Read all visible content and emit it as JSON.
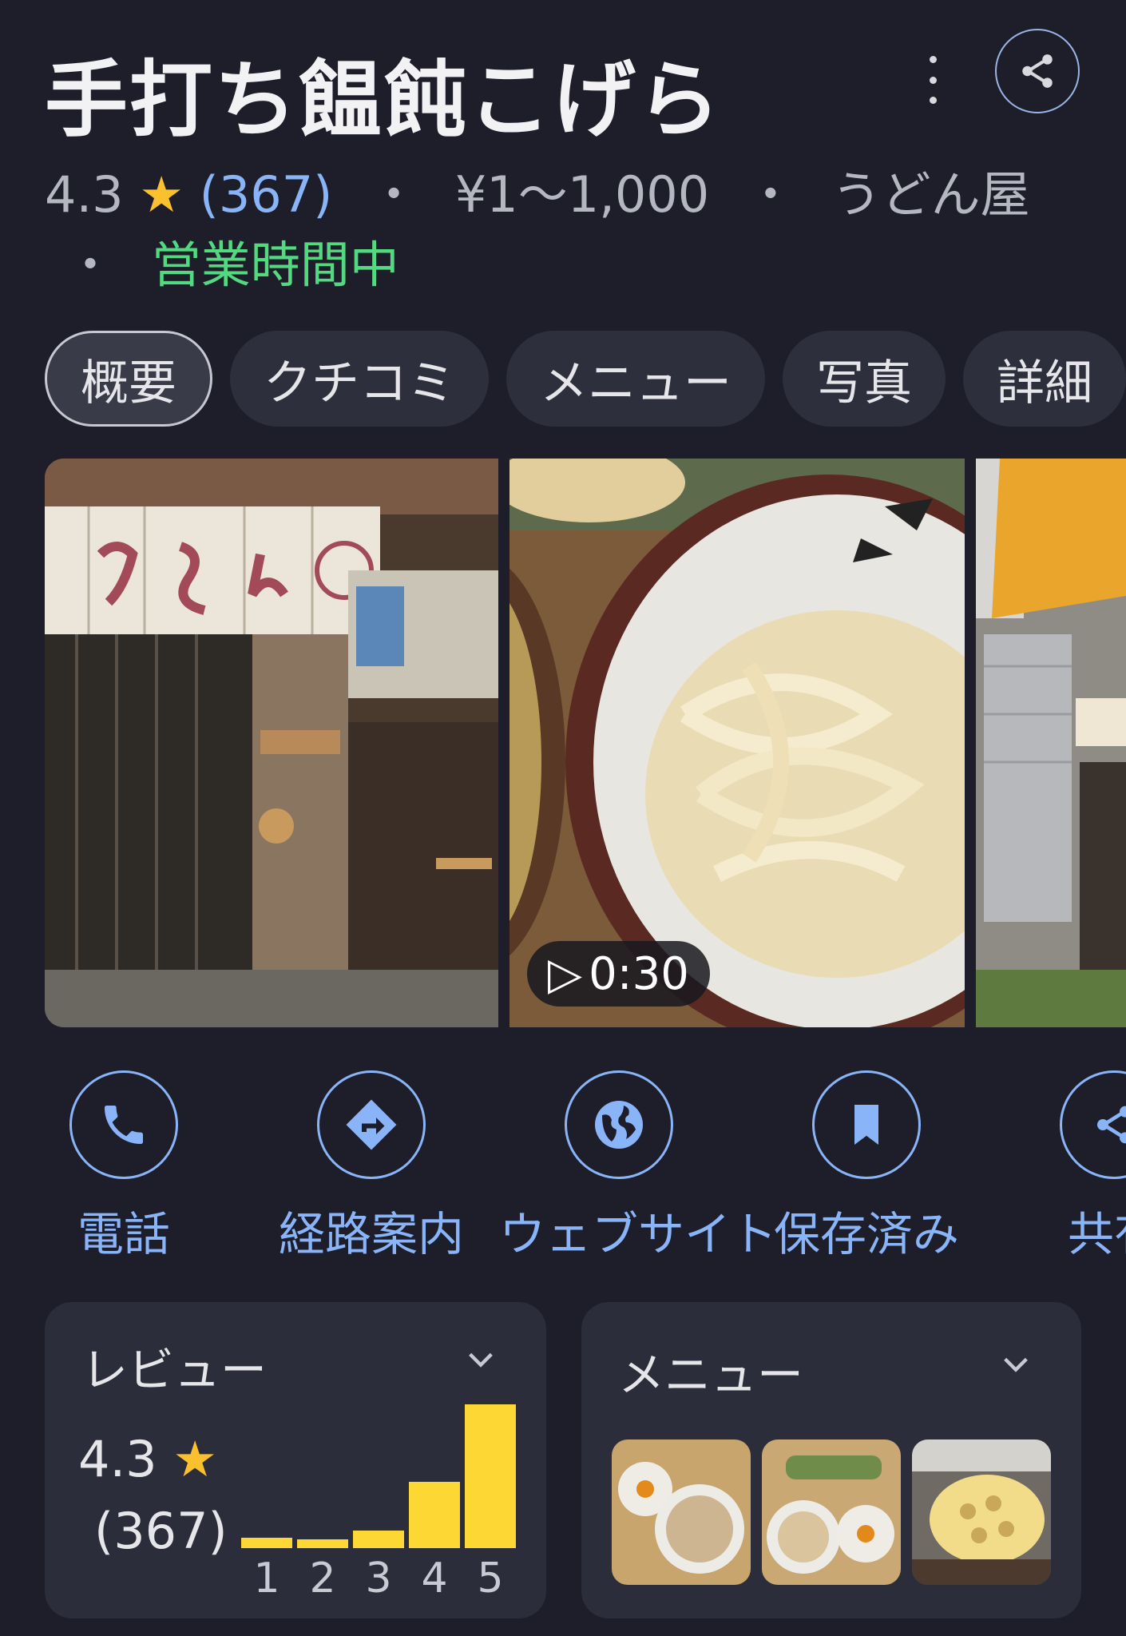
{
  "header": {
    "title": "手打ち饂飩こげら",
    "rating": "4.3",
    "star": "★",
    "review_count": "(367)",
    "separator": "・",
    "price": "¥1～1,000",
    "category": "うどん屋",
    "status": "営業時間中"
  },
  "tabs": [
    {
      "label": "概要"
    },
    {
      "label": "クチコミ"
    },
    {
      "label": "メニュー"
    },
    {
      "label": "写真"
    },
    {
      "label": "詳細"
    }
  ],
  "photos": {
    "video_duration": "0:30",
    "play_glyph": "▷"
  },
  "actions": [
    {
      "label": "電話",
      "icon": "phone-icon"
    },
    {
      "label": "経路案内",
      "icon": "directions-icon"
    },
    {
      "label": "ウェブサイト",
      "icon": "globe-icon"
    },
    {
      "label": "保存済み",
      "icon": "bookmark-icon"
    },
    {
      "label": "共有",
      "icon": "share-icon"
    }
  ],
  "review_card": {
    "title": "レビュー",
    "rating": "4.3",
    "star": "★",
    "count": "(367)"
  },
  "menu_card": {
    "title": "メニュー"
  },
  "chart_data": {
    "type": "bar",
    "categories": [
      "1",
      "2",
      "3",
      "4",
      "5"
    ],
    "values": [
      0.07,
      0.06,
      0.12,
      0.46,
      1.0
    ],
    "title": "",
    "xlabel": "",
    "ylabel": "",
    "ylim": [
      0,
      1
    ]
  },
  "colors": {
    "background": "#1d1e2a",
    "accent_blue": "#8ab4f8",
    "open_green": "#53d97f",
    "star_yellow": "#fbc02d",
    "bar_yellow": "#fdd835",
    "card": "#2b2d3a"
  }
}
